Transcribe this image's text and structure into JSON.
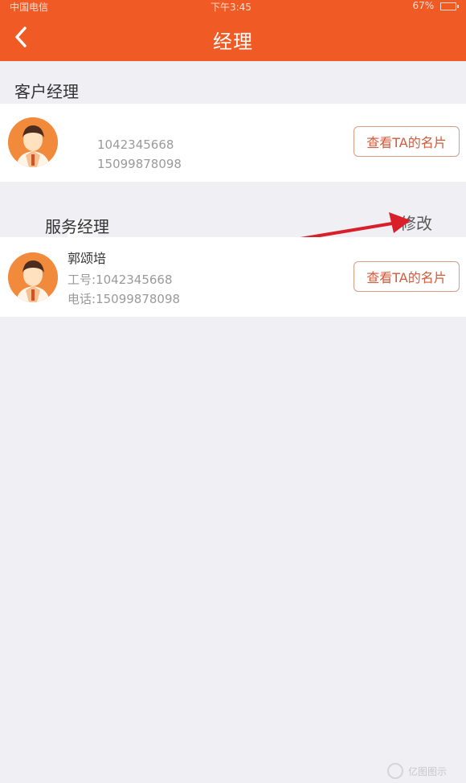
{
  "statusbar": {
    "carrier": "中国电信",
    "time": "下午3:45",
    "battery": "67%"
  },
  "navbar": {
    "title": "经理"
  },
  "sections": [
    {
      "title": "客户经理",
      "manager": {
        "name": "",
        "employee_id": "1042345668",
        "phone": "15099878098",
        "button_label": "查看TA的名片"
      }
    },
    {
      "title": "服务经理",
      "action_label": "修改",
      "manager": {
        "name": "郭颂培",
        "employee_id_label": "工号:",
        "employee_id": "1042345668",
        "phone_label": "电话:",
        "phone": "15099878098",
        "button_label": "查看TA的名片"
      }
    }
  ],
  "colors": {
    "brand": "#f05a24",
    "annotation_arrow": "#d91f28"
  },
  "icons": {
    "back": "chevron-left-icon",
    "avatar": "male-avatar-icon"
  },
  "watermark": {
    "text": "亿图图示"
  }
}
